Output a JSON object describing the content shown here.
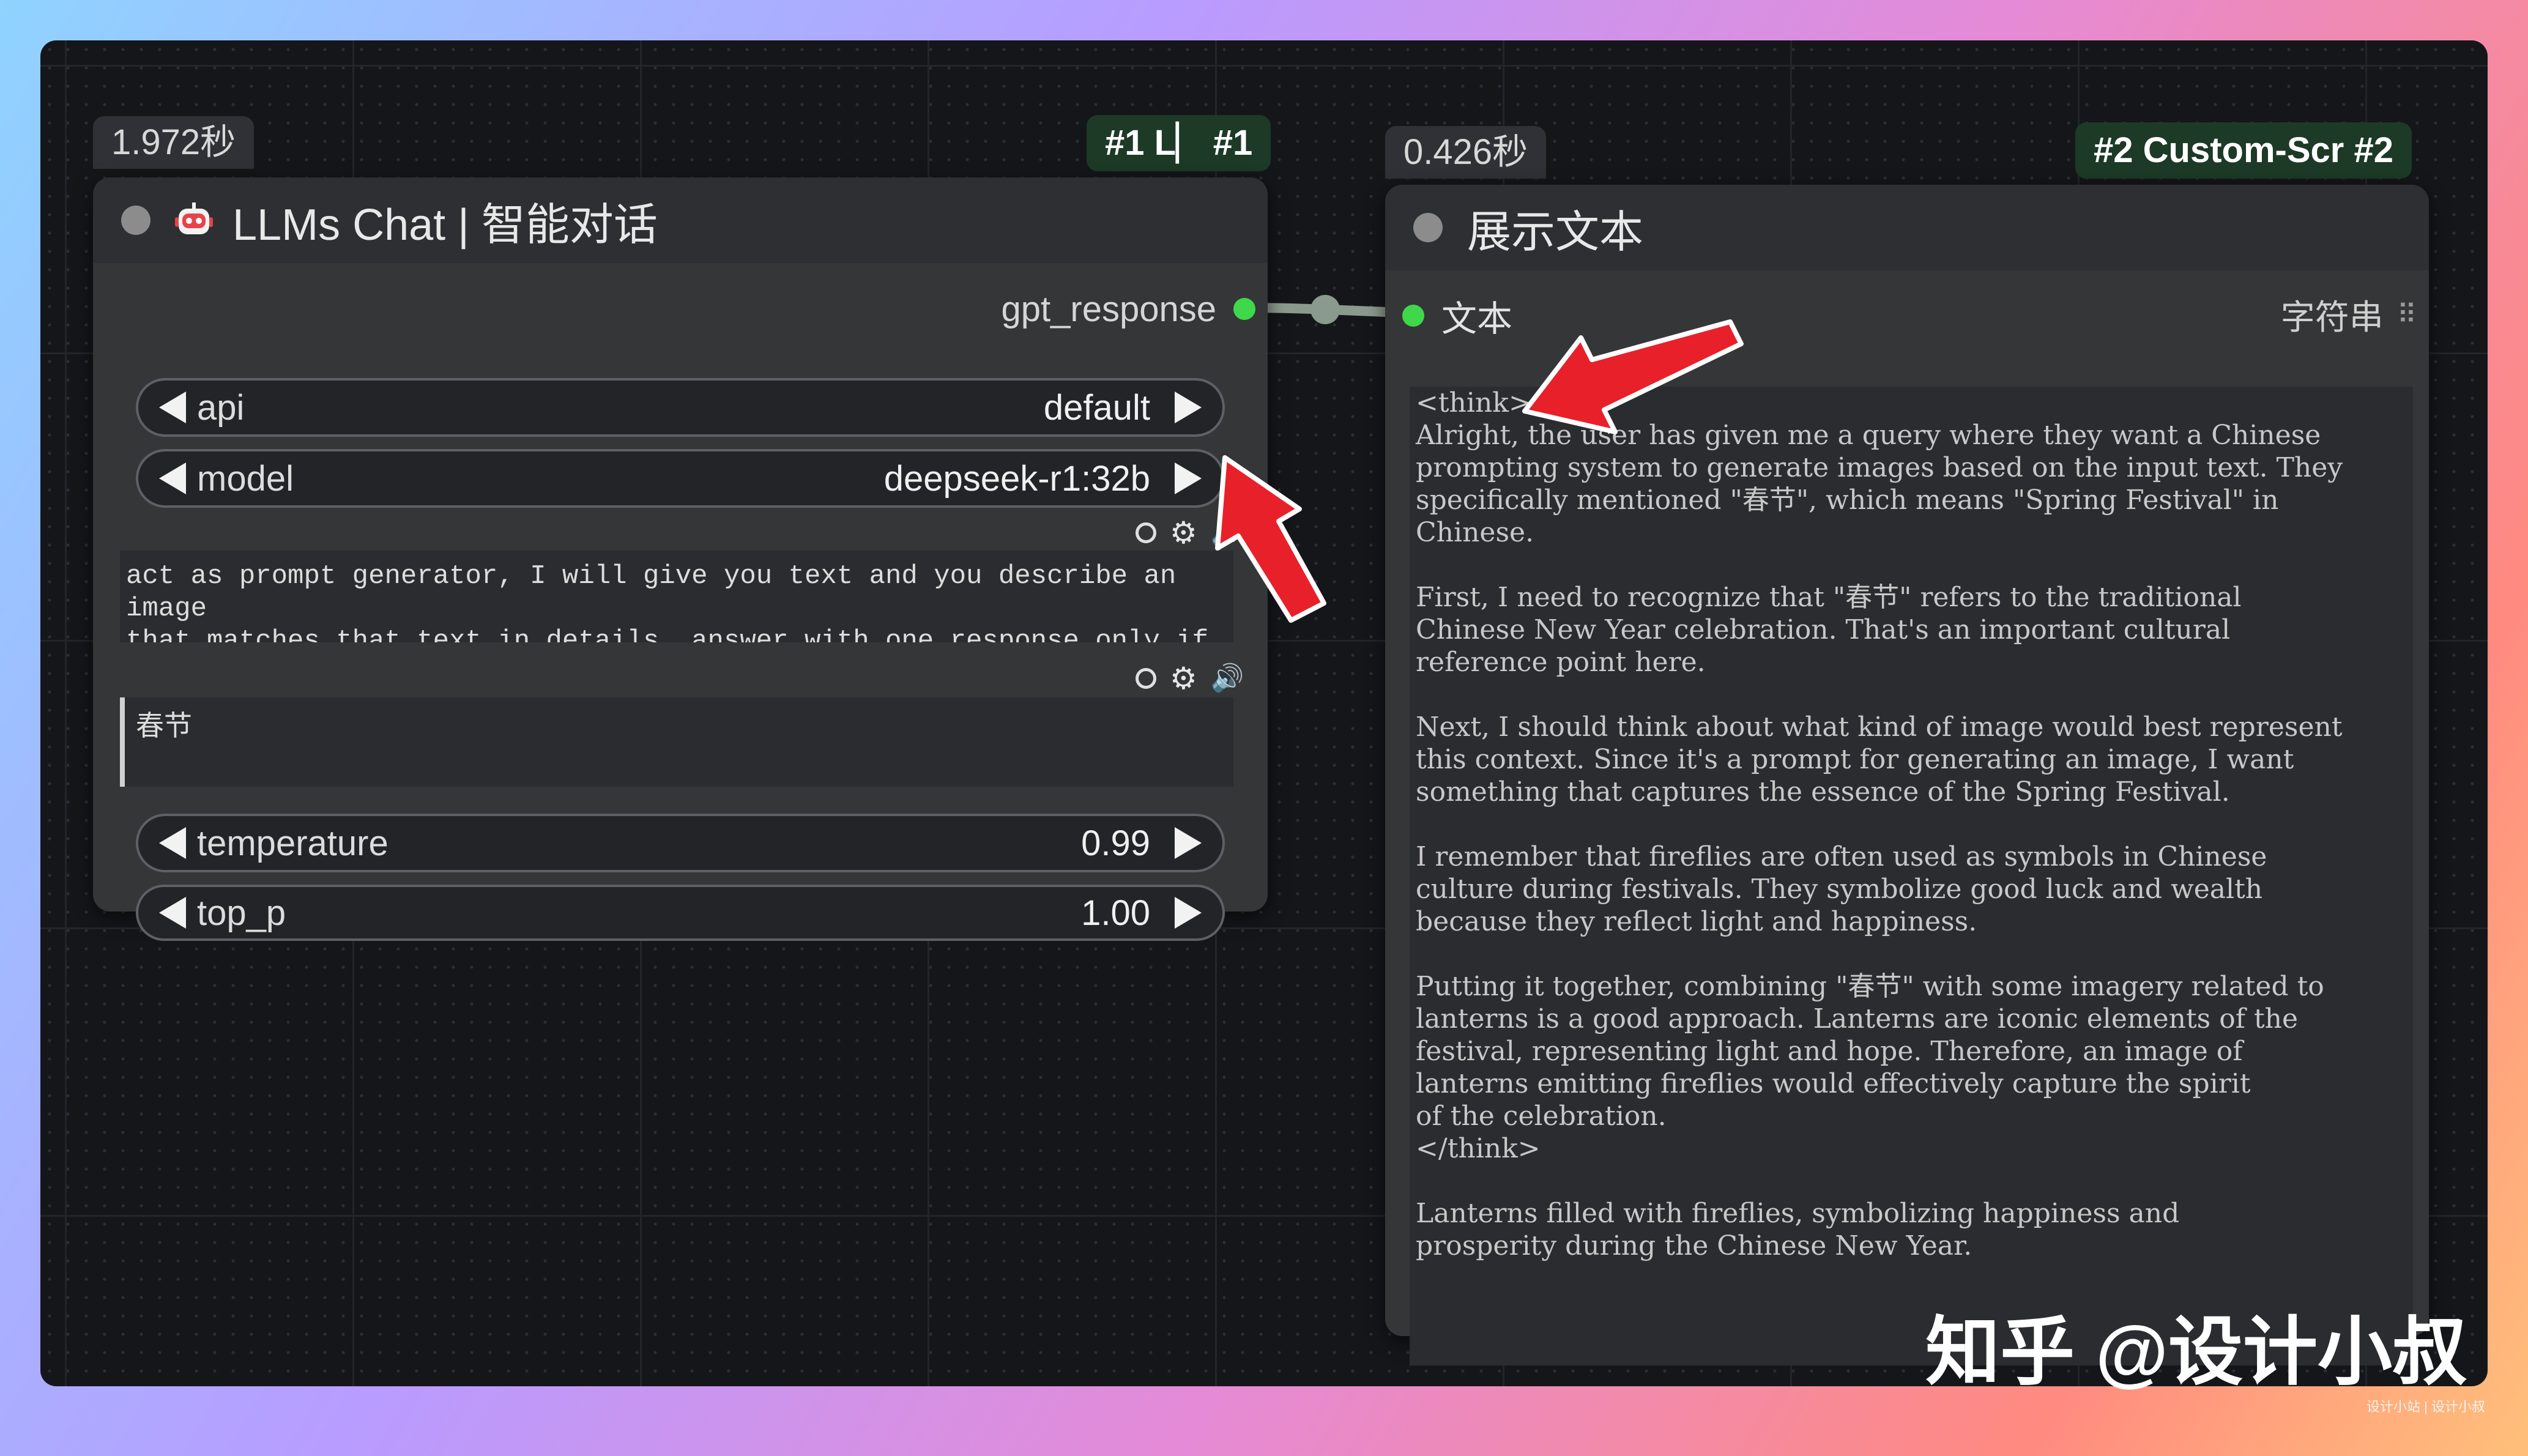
{
  "node1": {
    "time": "1.972秒",
    "badge": "#1 L▏ #1",
    "title": "LLMs Chat | 智能对话",
    "output_label": "gpt_response",
    "api_label": "api",
    "api_value": "default",
    "model_label": "model",
    "model_value": "deepseek-r1:32b",
    "prompt_text": "act as prompt generator, I will give you text and you describe an image\nthat matches that text in details, answer with one response only.if I\ninput in Chinese to communicate with you, but it is crucial that your",
    "input_text": "春节",
    "temperature_label": "temperature",
    "temperature_value": "0.99",
    "top_p_label": "top_p",
    "top_p_value": "1.00"
  },
  "node2": {
    "time": "0.426秒",
    "badge": "#2 Custom-Scr #2",
    "title": "展示文本",
    "input_label": "文本",
    "type_label": "字符串",
    "text": "<think>\nAlright, the user has given me a query where they want a Chinese\nprompting system to generate images based on the input text. They\nspecifically mentioned \"春节\", which means \"Spring Festival\" in\nChinese.\n\nFirst, I need to recognize that \"春节\" refers to the traditional\nChinese New Year celebration. That's an important cultural\nreference point here.\n\nNext, I should think about what kind of image would best represent\nthis context. Since it's a prompt for generating an image, I want\nsomething that captures the essence of the Spring Festival.\n\nI remember that fireflies are often used as symbols in Chinese\nculture during festivals. They symbolize good luck and wealth\nbecause they reflect light and happiness.\n\nPutting it together, combining \"春节\" with some imagery related to\nlanterns is a good approach. Lanterns are iconic elements of the\nfestival, representing light and hope. Therefore, an image of\nlanterns emitting fireflies would effectively capture the spirit\nof the celebration.\n</think>\n\nLanterns filled with fireflies, symbolizing happiness and\nprosperity during the Chinese New Year."
  },
  "watermark": "知乎 @设计小叔",
  "footnote": "设计小站 | 设计小叔",
  "colors": {
    "accent_green": "#3fd84a",
    "annotation_red": "#e8202a",
    "canvas_bg": "#15161a"
  },
  "icons": [
    "robot-icon",
    "status-dot",
    "settings-gear-icon",
    "speaker-icon",
    "grid-icon",
    "arrow-left-icon",
    "arrow-right-icon"
  ]
}
